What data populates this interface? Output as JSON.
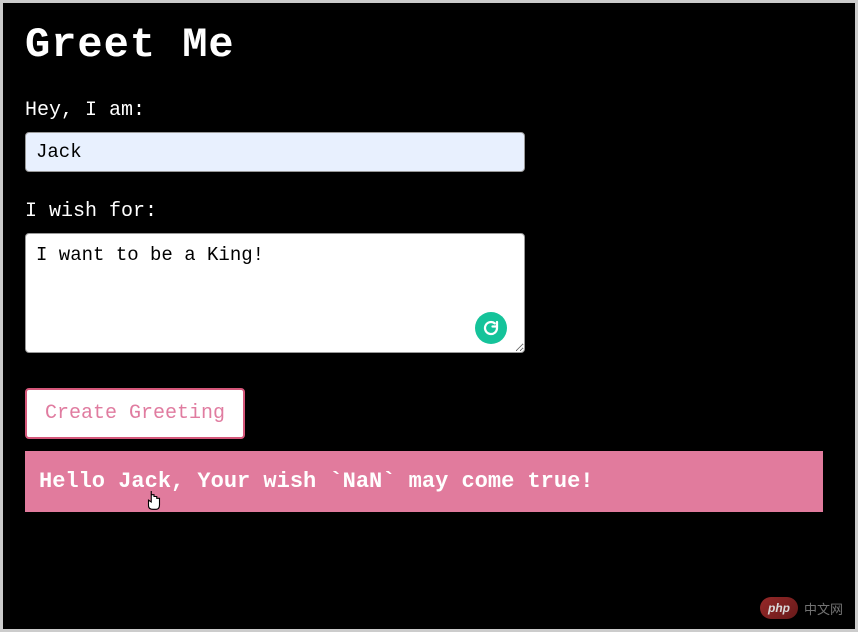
{
  "page": {
    "title": "Greet Me"
  },
  "form": {
    "name_label": "Hey, I am:",
    "name_value": "Jack",
    "wish_label": "I wish for:",
    "wish_value": "I want to be a King!",
    "submit_label": "Create Greeting"
  },
  "output": {
    "message": "Hello Jack, Your wish `NaN` may come true!"
  },
  "icons": {
    "grammarly": "grammarly-icon",
    "cursor": "pointer-cursor"
  },
  "watermark": {
    "badge": "php",
    "text": "中文网"
  },
  "colors": {
    "background": "#000000",
    "text": "#ffffff",
    "input_bg": "#e8f0fe",
    "button_border": "#d4577a",
    "button_text": "#e07ca0",
    "banner_bg": "#e17b9d",
    "grammarly": "#15c39a"
  }
}
